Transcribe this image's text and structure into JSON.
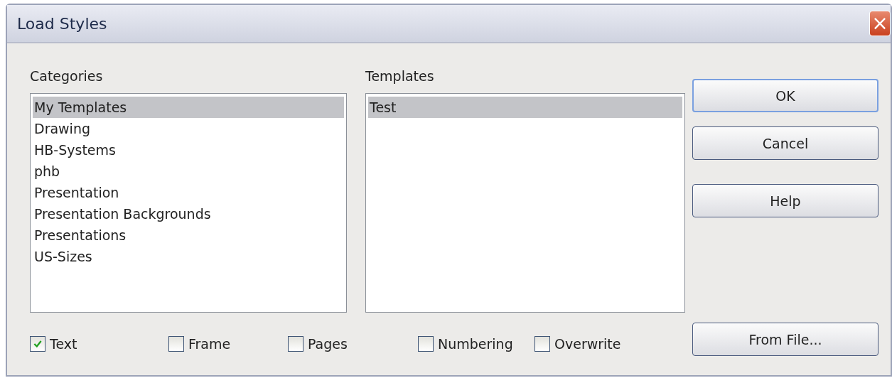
{
  "window": {
    "title": "Load Styles",
    "close": "×"
  },
  "categories": {
    "label": "Categories",
    "items": [
      {
        "label": "My Templates",
        "selected": true
      },
      {
        "label": "Drawing",
        "selected": false
      },
      {
        "label": "HB-Systems",
        "selected": false
      },
      {
        "label": "phb",
        "selected": false
      },
      {
        "label": "Presentation",
        "selected": false
      },
      {
        "label": "Presentation Backgrounds",
        "selected": false
      },
      {
        "label": "Presentations",
        "selected": false
      },
      {
        "label": "US-Sizes",
        "selected": false
      }
    ]
  },
  "templates": {
    "label": "Templates",
    "items": [
      {
        "label": "Test",
        "selected": true
      }
    ]
  },
  "buttons": [
    "OK",
    "Cancel",
    "Help"
  ],
  "options": [
    {
      "label": "Text",
      "checked": true
    },
    {
      "label": "Frame",
      "checked": false
    },
    {
      "label": "Pages",
      "checked": false
    },
    {
      "label": "Numbering",
      "checked": false
    },
    {
      "label": "Overwrite",
      "checked": false
    }
  ],
  "from_file_button": "From File..."
}
